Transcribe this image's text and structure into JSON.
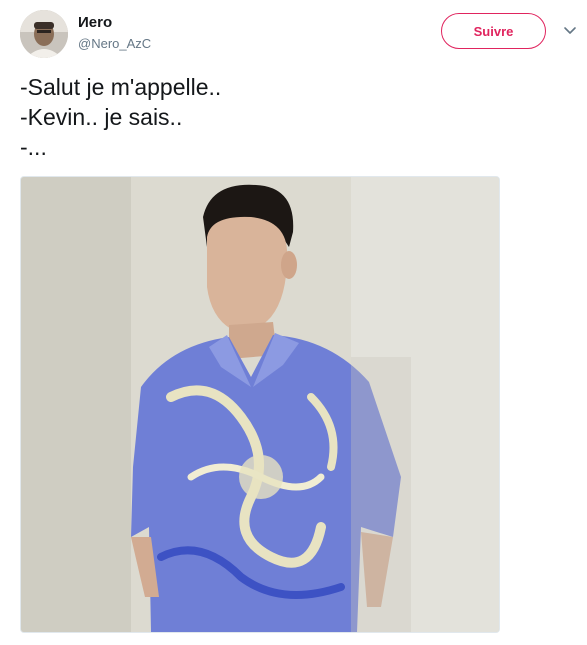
{
  "user": {
    "display_name": "Иero",
    "handle": "@Nero_AzC"
  },
  "follow_button": {
    "label": "Suivre"
  },
  "tweet": {
    "lines": [
      "-Salut je m'appelle..",
      "-Kevin.. je sais..",
      "-..."
    ]
  },
  "colors": {
    "follow_accent": "#e0245e",
    "handle_gray": "#657786",
    "text": "#14171a"
  },
  "icons": {
    "menu": "chevron-down-icon"
  }
}
